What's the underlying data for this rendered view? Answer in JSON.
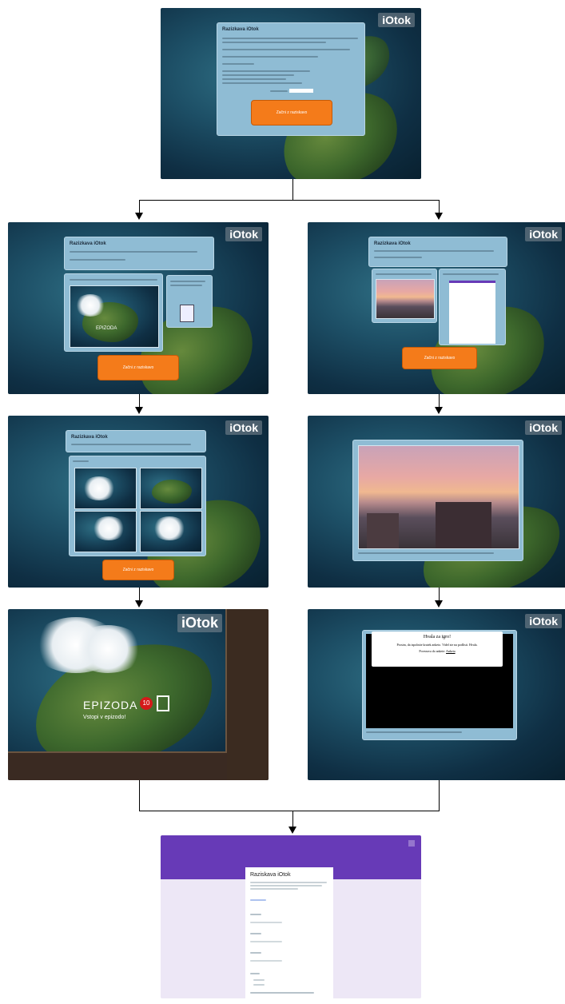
{
  "logo": "iOtok",
  "screens": {
    "start": {
      "title": "Razizkava iOtok",
      "button": "Začni z raziskavo"
    },
    "left1": {
      "title": "Razizkava iOtok",
      "button": "Začni z raziskavo",
      "episode_label": "EPIZODA"
    },
    "right1": {
      "title": "Razizkava iOtok",
      "button": "Začni z raziskavo"
    },
    "left2": {
      "title": "Razizkava iOtok",
      "button": "Začni z raziskavo"
    },
    "left3": {
      "episode_label": "EPIZODA",
      "episode_number": "10",
      "episode_sub": "Vstopi v epizodo!"
    },
    "right3": {
      "line1": "Hvala za igro!",
      "line2": "Prosim, da izpolnite kratek anketo. Videl ste na podlisti. Hvala.",
      "line3": "Povezava do ankete:",
      "link": "Anketa"
    },
    "form": {
      "title": "Raziskava iOtok"
    }
  }
}
